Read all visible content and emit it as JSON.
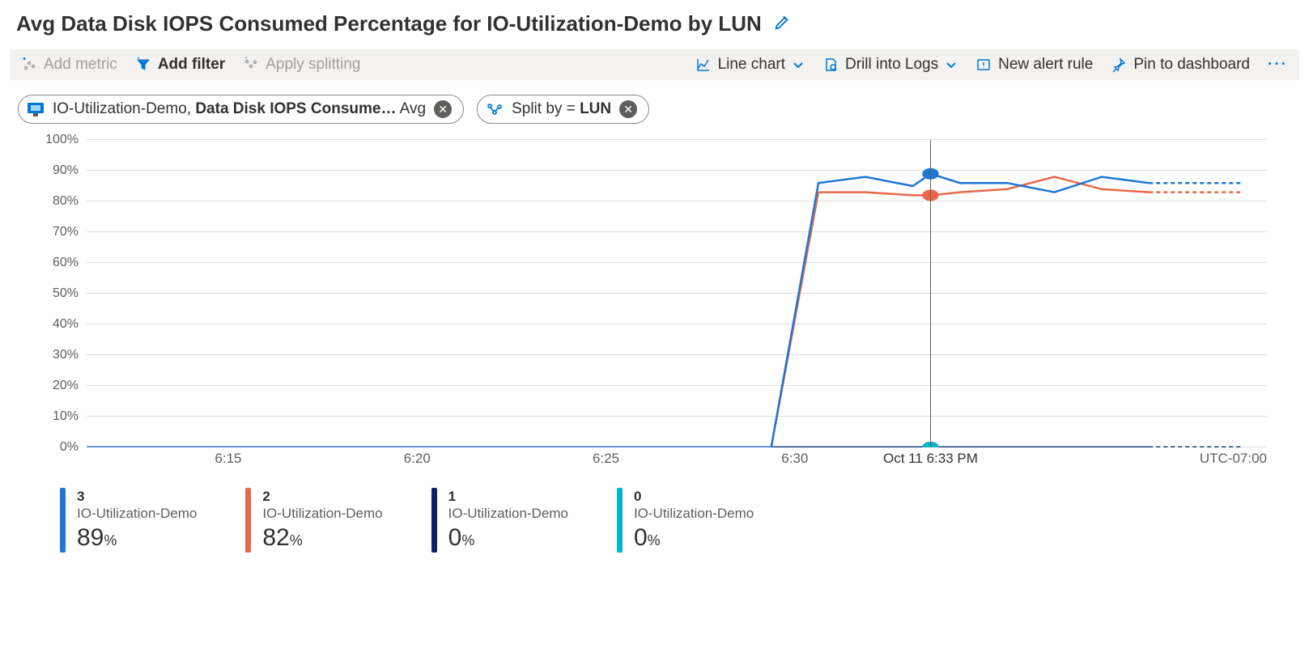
{
  "title": "Avg Data Disk IOPS Consumed Percentage for IO-Utilization-Demo by LUN",
  "toolbar": {
    "add_metric": "Add metric",
    "add_filter": "Add filter",
    "apply_split": "Apply splitting",
    "line_chart": "Line chart",
    "drill_logs": "Drill into Logs",
    "new_alert": "New alert rule",
    "pin_dash": "Pin to dashboard"
  },
  "pills": {
    "metric_resource": "IO-Utilization-Demo, ",
    "metric_name": "Data Disk IOPS Consume…",
    "metric_agg": " Avg",
    "split_prefix": "Split by = ",
    "split_dim": "LUN"
  },
  "chart_data": {
    "type": "line",
    "ylabel": "",
    "xlabel": "",
    "ylim": [
      0,
      100
    ],
    "y_ticks": [
      "0%",
      "10%",
      "20%",
      "30%",
      "40%",
      "50%",
      "60%",
      "70%",
      "80%",
      "90%",
      "100%"
    ],
    "x_ticks": [
      {
        "label": "6:15",
        "pos": 0.12
      },
      {
        "label": "6:20",
        "pos": 0.28
      },
      {
        "label": "6:25",
        "pos": 0.44
      },
      {
        "label": "6:30",
        "pos": 0.6
      }
    ],
    "tz_label": "UTC-07:00",
    "cursor": {
      "pos": 0.715,
      "label": "Oct 11 6:33 PM"
    },
    "x": [
      0.0,
      0.08,
      0.16,
      0.24,
      0.32,
      0.4,
      0.48,
      0.54,
      0.58,
      0.62,
      0.66,
      0.7,
      0.715,
      0.74,
      0.78,
      0.82,
      0.86,
      0.9
    ],
    "dashed_x": [
      0.9,
      0.94,
      0.98
    ],
    "series": [
      {
        "name": "3",
        "resource": "IO-Utilization-Demo",
        "color": "#1f77d4",
        "current": 89,
        "values": [
          0,
          0,
          0,
          0,
          0,
          0,
          0,
          0,
          0,
          86,
          88,
          85,
          89,
          86,
          86,
          83,
          88,
          86
        ],
        "dashed": [
          86,
          86,
          86
        ]
      },
      {
        "name": "2",
        "resource": "IO-Utilization-Demo",
        "color": "#e8684a",
        "current": 82,
        "values": [
          0,
          0,
          0,
          0,
          0,
          0,
          0,
          0,
          0,
          83,
          83,
          82,
          82,
          83,
          84,
          88,
          84,
          83
        ],
        "dashed": [
          83,
          83,
          83
        ]
      },
      {
        "name": "1",
        "resource": "IO-Utilization-Demo",
        "color": "#0b1f6b",
        "current": 0,
        "values": [
          0,
          0,
          0,
          0,
          0,
          0,
          0,
          0,
          0,
          0,
          0,
          0,
          0,
          0,
          0,
          0,
          0,
          0
        ],
        "dashed": [
          0,
          0,
          0
        ]
      },
      {
        "name": "0",
        "resource": "IO-Utilization-Demo",
        "color": "#00b7c3",
        "current": 0,
        "values": [
          0,
          0,
          0,
          0,
          0,
          0,
          0,
          0,
          0,
          0,
          0,
          0,
          0,
          0,
          0,
          0,
          0,
          0
        ],
        "dashed": [
          0,
          0,
          0
        ]
      }
    ]
  }
}
